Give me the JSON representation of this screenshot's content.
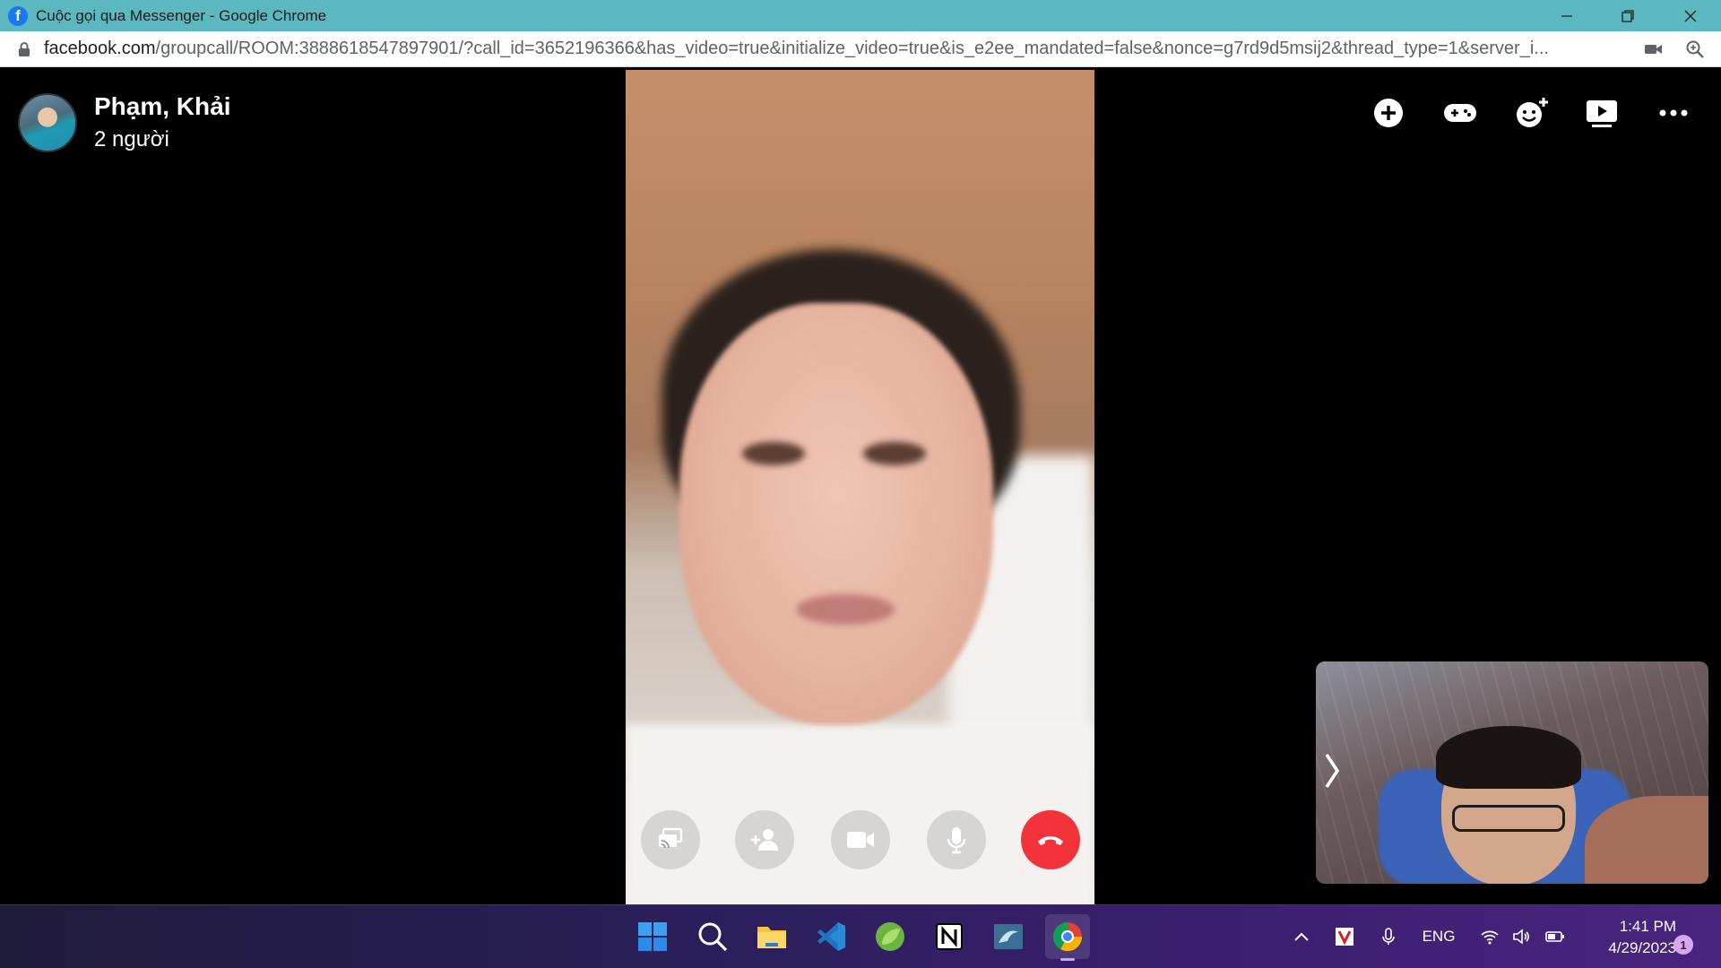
{
  "window": {
    "title": "Cuộc gọi qua Messenger - Google Chrome",
    "favicon_letter": "f"
  },
  "address_bar": {
    "host": "facebook.com",
    "path": "/groupcall/ROOM:3888618547897901/?call_id=3652196366&has_video=true&initialize_video=true&is_e2ee_mandated=false&nonce=g7rd9d5msij2&thread_type=1&server_i..."
  },
  "call": {
    "name": "Phạm, Khải",
    "participants": "2 người",
    "top_actions": [
      "add-icon",
      "game-icon",
      "effects-icon",
      "watch-together-icon",
      "more-icon"
    ],
    "controls": [
      "share-screen-icon",
      "add-person-icon",
      "camera-icon",
      "microphone-icon",
      "end-call-icon"
    ]
  },
  "taskbar": {
    "apps": [
      "windows-start",
      "search",
      "file-explorer",
      "visual-studio-code",
      "spring-tool",
      "notion",
      "mysql-workbench",
      "google-chrome"
    ],
    "tray_language": "ENG",
    "time": "1:41 PM",
    "date": "4/29/2023",
    "notification_count": "1"
  },
  "colors": {
    "titlebar": "#5bb8c1",
    "end_call": "#f3333a",
    "taskbar_start": "#1f1b3a",
    "taskbar_end": "#4a2580"
  }
}
